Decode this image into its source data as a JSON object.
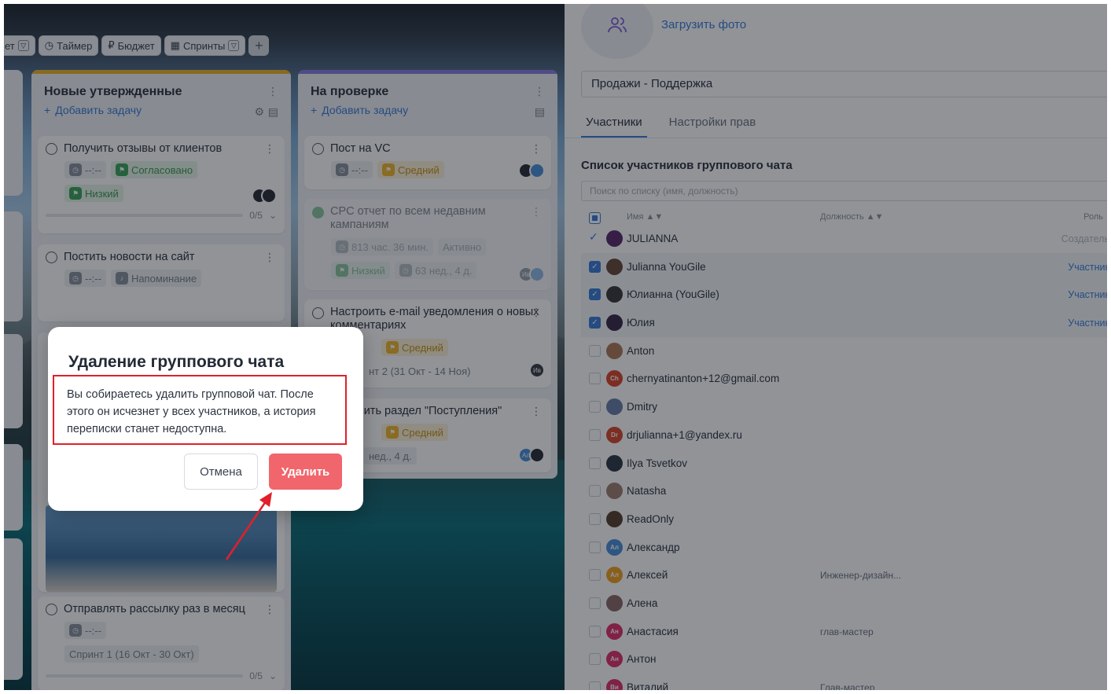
{
  "toolbar": {
    "cut_item": "ет",
    "timer": "Таймер",
    "budget": "Бюджет",
    "sprints": "Спринты",
    "plus": "+"
  },
  "columns": [
    {
      "title": "Новые утвержденные",
      "add_task": "Добавить задачу",
      "cards": [
        {
          "title": "Получить отзывы от клиентов",
          "time": "--:--",
          "tag_status": "Согласовано",
          "tag_priority": "Низкий",
          "progress": "0/5"
        },
        {
          "title": "Постить новости на сайт",
          "time": "--:--",
          "tag_reminder": "Напоминание"
        },
        {
          "title": "Отправлять рассылку раз в месяц",
          "time": "--:--",
          "sprint": "Спринт 1 (16 Окт - 30 Окт)",
          "progress": "0/5"
        }
      ]
    },
    {
      "title": "На проверке",
      "add_task": "Добавить задачу",
      "cards": [
        {
          "title": "Пост на VC",
          "time": "--:--",
          "tag_priority": "Средний"
        },
        {
          "title": "СPC отчет по всем недавним кампаниям",
          "time": "813 час. 36 мин.",
          "status": "Активно",
          "tag_priority": "Низкий",
          "duration": "63 нед., 4 д.",
          "avatar": "Ив"
        },
        {
          "title": "Настроить e-mail уведомления о новых комментариях",
          "tag_priority": "Средний",
          "sprint_tail": "нт 2 (31 Окт - 14 Ноя)",
          "avatar": "Ив"
        },
        {
          "title_tail": "вить раздел \"Поступления\"",
          "tag_priority": "Средний",
          "duration_tail": "нед., 4 д.",
          "avatar": "Ал"
        }
      ]
    }
  ],
  "panel": {
    "upload_photo": "Загрузить фото",
    "chat_name": "Продажи - Поддержка",
    "tabs": [
      "Участники",
      "Настройки прав"
    ],
    "list_title": "Список участников группового чата",
    "search_placeholder": "Поиск по списку (имя, должность)",
    "headers": {
      "name": "Имя ▲▼",
      "position": "Должность ▲▼",
      "role": "Роль"
    },
    "members": [
      {
        "name": "JULIANNA",
        "role": "Создатель",
        "state": "creator",
        "initials": "",
        "color": "#5b2a6e"
      },
      {
        "name": "Julianna YouGile",
        "role": "Участник",
        "state": "on",
        "initials": "",
        "color": "#6a4a3a"
      },
      {
        "name": "Юлианна (YouGile)",
        "role": "Участник",
        "state": "on",
        "initials": "",
        "color": "#3a3a3a"
      },
      {
        "name": "Юлия",
        "role": "Участник",
        "state": "on",
        "initials": "",
        "color": "#3b2a4a"
      },
      {
        "name": "Anton",
        "state": "off",
        "initials": "",
        "color": "#b07a5a"
      },
      {
        "name": "chernyatinanton+12@gmail.com",
        "state": "off",
        "initials": "Ch",
        "color": "#d9472b"
      },
      {
        "name": "Dmitry",
        "state": "off",
        "initials": "",
        "color": "#6a7fa8"
      },
      {
        "name": "drjulianna+1@yandex.ru",
        "state": "off",
        "initials": "Dr",
        "color": "#d9472b"
      },
      {
        "name": "Ilya Tsvetkov",
        "state": "off",
        "initials": "",
        "color": "#2e3a46"
      },
      {
        "name": "Natasha",
        "state": "off",
        "initials": "",
        "color": "#a08070"
      },
      {
        "name": "ReadOnly",
        "state": "off",
        "initials": "",
        "color": "#5a4030"
      },
      {
        "name": "Александр",
        "state": "off",
        "initials": "Ал",
        "color": "#4a90d9"
      },
      {
        "name": "Алексей",
        "position": "Инженер-дизайн...",
        "state": "off",
        "initials": "Ал",
        "color": "#f0a020"
      },
      {
        "name": "Алена",
        "state": "off",
        "initials": "",
        "color": "#8a6a6a"
      },
      {
        "name": "Анастасия",
        "position": "глав-мастер",
        "state": "off",
        "initials": "Ан",
        "color": "#e0306a"
      },
      {
        "name": "Антон",
        "state": "off",
        "initials": "Ан",
        "color": "#e0306a"
      },
      {
        "name": "Виталий",
        "position": "Глав-мастер",
        "state": "off",
        "initials": "Ви",
        "color": "#e0306a"
      }
    ]
  },
  "modal": {
    "title": "Удаление группового чата",
    "text": "Вы собираетесь удалить групповой чат. После этого он исчезнет у всех участников, а история переписки станет недоступна.",
    "cancel": "Отмена",
    "delete": "Удалить"
  },
  "colors": {
    "accent": "#3b7dd8",
    "danger": "#f0666c",
    "highlight": "#e0202a"
  }
}
